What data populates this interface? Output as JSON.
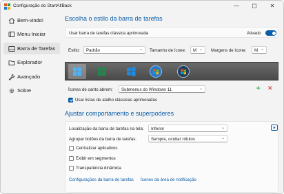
{
  "window": {
    "title": "Configuração do StartAllBack",
    "accent": "#0a5ea8"
  },
  "titlebar_buttons": {
    "minimize": "—",
    "maximize": "☐",
    "close": "✕"
  },
  "sidebar": {
    "items": [
      {
        "label": "Bem-vindo!",
        "icon": "house-icon"
      },
      {
        "label": "Menu Iniciar",
        "icon": "start-menu-icon"
      },
      {
        "label": "Barra de Tarefas",
        "icon": "taskbar-icon",
        "active": true
      },
      {
        "label": "Explorador",
        "icon": "folder-icon"
      },
      {
        "label": "Avançado",
        "icon": "wrench-icon"
      },
      {
        "label": "Sobre",
        "icon": "gear-icon"
      }
    ]
  },
  "style_section": {
    "title": "Escolha o estilo da barra de tarefas",
    "classic_label": "Usar barra de tarefas clássica aprimorada",
    "classic_state": "Ativado",
    "style_label": "Estilo:",
    "style_value": "Padrão",
    "icon_size_label": "Tamanho de ícone:",
    "icon_size_value": "M",
    "icon_margin_label": "Margens de ícone:",
    "icon_margin_value": "M",
    "corner_label": "Ícones de canto abrem:",
    "corner_value": "Submenus do Windows 11",
    "jump_lists_label": "Usar listas de atalho clássicas aprimoradas",
    "add_symbol": "+",
    "remove_symbol": "✕"
  },
  "behavior_section": {
    "title": "Ajustar comportamento e superpoderes",
    "location_label": "Localização da barra de tarefas na tela:",
    "location_value": "Inferior",
    "group_label": "Agrupar botões da barra de tarefas:",
    "group_value": "Sempre, ocultar rótulos",
    "center_label": "Centralizar aplicativos",
    "segments_label": "Exibir em segmentos",
    "transparency_label": "Transparência dinâmica",
    "link_taskbar_settings": "Configurações da barra de tarefas",
    "link_notification_icons": "Ícones da área de notificação"
  }
}
